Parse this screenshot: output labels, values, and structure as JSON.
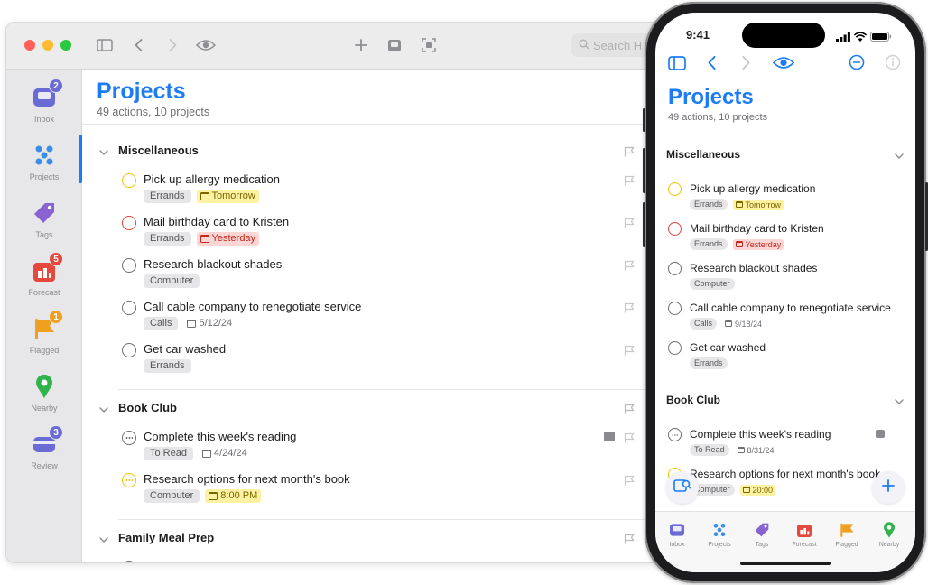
{
  "mac": {
    "search_placeholder": "Search H",
    "sidebar": [
      {
        "label": "Inbox",
        "badge": "2",
        "color": "#6b6bd6"
      },
      {
        "label": "Projects",
        "badge": "",
        "color": "#3b8ee8"
      },
      {
        "label": "Tags",
        "badge": "",
        "color": "#8a63d2"
      },
      {
        "label": "Forecast",
        "badge": "5",
        "color": "#e5483c"
      },
      {
        "label": "Flagged",
        "badge": "1",
        "color": "#f0a020"
      },
      {
        "label": "Nearby",
        "badge": "",
        "color": "#2fb34a"
      },
      {
        "label": "Review",
        "badge": "3",
        "color": "#6b6bd6"
      }
    ],
    "title": "Projects",
    "subtitle": "49 actions, 10 projects",
    "groups": [
      {
        "title": "Miscellaneous",
        "tasks": [
          {
            "title": "Pick up allergy medication",
            "tag": "Errands",
            "due": "Tomorrow",
            "due_style": "yellow",
            "circle": "#f2c400"
          },
          {
            "title": "Mail birthday card to Kristen",
            "tag": "Errands",
            "due": "Yesterday",
            "due_style": "red",
            "circle": "#e0443a"
          },
          {
            "title": "Research blackout shades",
            "tag": "Computer",
            "due": "",
            "due_style": "",
            "circle": "#6e6e73"
          },
          {
            "title": "Call cable company to renegotiate service",
            "tag": "Calls",
            "due": "5/12/24",
            "due_style": "plain",
            "circle": "#6e6e73"
          },
          {
            "title": "Get car washed",
            "tag": "Errands",
            "due": "",
            "due_style": "",
            "circle": "#6e6e73"
          }
        ]
      },
      {
        "title": "Book Club",
        "tasks": [
          {
            "title": "Complete this week's reading",
            "tag": "To Read",
            "due": "4/24/24",
            "due_style": "plain",
            "circle": "#6e6e73",
            "note": true
          },
          {
            "title": "Research options for next month's book",
            "tag": "Computer",
            "due": "8:00 PM",
            "due_style": "yellow",
            "circle": "#f2c400"
          }
        ]
      },
      {
        "title": "Family Meal Prep",
        "tasks": [
          {
            "title": "Plan next week's meal schedule",
            "tag": "",
            "due": "",
            "due_style": "",
            "circle": "#6e6e73",
            "note": true
          }
        ]
      }
    ]
  },
  "phone": {
    "time": "9:41",
    "title": "Projects",
    "subtitle": "49 actions, 10 projects",
    "groups": [
      {
        "title": "Miscellaneous",
        "tasks": [
          {
            "title": "Pick up allergy medication",
            "tag": "Errands",
            "due": "Tomorrow",
            "due_style": "yellow",
            "circle": "#f2c400"
          },
          {
            "title": "Mail birthday card to Kristen",
            "tag": "Errands",
            "due": "Yesterday",
            "due_style": "red",
            "circle": "#e0443a"
          },
          {
            "title": "Research blackout shades",
            "tag": "Computer",
            "due": "",
            "due_style": "",
            "circle": "#6e6e73"
          },
          {
            "title": "Call cable company to renegotiate service",
            "tag": "Calls",
            "due": "9/18/24",
            "due_style": "plain",
            "circle": "#6e6e73"
          },
          {
            "title": "Get car washed",
            "tag": "Errands",
            "due": "",
            "due_style": "",
            "circle": "#6e6e73"
          }
        ]
      },
      {
        "title": "Book Club",
        "tasks": [
          {
            "title": "Complete this week's reading",
            "tag": "To Read",
            "due": "8/31/24",
            "due_style": "plain",
            "circle": "#6e6e73"
          },
          {
            "title": "Research options for next month's book",
            "tag": "Computer",
            "due": "20:00",
            "due_style": "yellow",
            "circle": "#f2c400"
          }
        ]
      },
      {
        "title": "Family Meal Prep",
        "tasks": []
      }
    ],
    "tabs": [
      {
        "label": "Inbox",
        "badge": "",
        "color": "#6b6bd6"
      },
      {
        "label": "Projects",
        "badge": "",
        "color": "#3b8ee8"
      },
      {
        "label": "Tags",
        "badge": "",
        "color": "#8a63d2"
      },
      {
        "label": "Forecast",
        "badge": "",
        "color": "#e5483c"
      },
      {
        "label": "Flagged",
        "badge": "",
        "color": "#f0a020"
      },
      {
        "label": "Nearby",
        "badge": "",
        "color": "#2fb34a"
      }
    ]
  },
  "colors": {
    "accent": "#1b7cf4"
  }
}
